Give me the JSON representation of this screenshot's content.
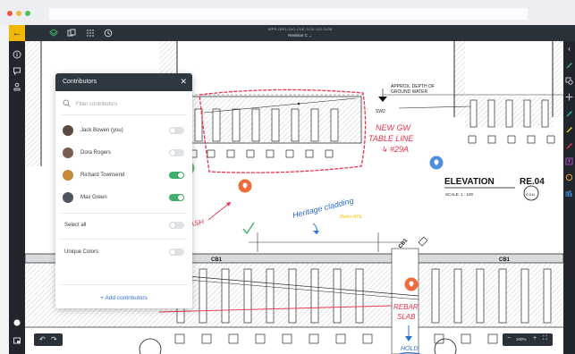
{
  "browser": {
    "dot_colors": [
      "#f0574a",
      "#f6b93b",
      "#4cc655"
    ]
  },
  "header": {
    "document_title": "WPR-DRG-JAC-CDE-3-00-102-3108",
    "revision_label": "Revision C",
    "revision_chevron": "⌄",
    "icons": [
      "layers-icon",
      "pages-icon",
      "grid-icon",
      "history-icon"
    ]
  },
  "left_toolbar": {
    "back_label": "←",
    "icons": [
      "info-icon",
      "comment-icon",
      "stamp-icon",
      "status-dot-icon",
      "settings-icon"
    ]
  },
  "right_toolbar": {
    "icons": [
      {
        "name": "chevron-left-icon",
        "color": "#ffffff"
      },
      {
        "name": "pen-green-icon",
        "color": "#3fb06a"
      },
      {
        "name": "shapes-icon",
        "color": "#cfd3d8"
      },
      {
        "name": "move-icon",
        "color": "#cfd3d8"
      },
      {
        "name": "pen-teal-icon",
        "color": "#27b5a6"
      },
      {
        "name": "pen-yellow-icon",
        "color": "#f2d20a"
      },
      {
        "name": "pen-red-icon",
        "color": "#e8334a"
      },
      {
        "name": "text-icon",
        "color": "#b54fd6"
      },
      {
        "name": "circle-icon",
        "color": "#f2a61b"
      },
      {
        "name": "measure-icon",
        "color": "#3b8fe0"
      }
    ]
  },
  "contributors_panel": {
    "title": "Contributors",
    "close_label": "✕",
    "filter_placeholder": "Filter contributors",
    "contributors": [
      {
        "name": "Jack Bowen (you)",
        "enabled": false,
        "avatar_color": "#5b4a3f"
      },
      {
        "name": "Dora Rogers",
        "enabled": false,
        "avatar_color": "#7a5c4e"
      },
      {
        "name": "Richard Townsend",
        "enabled": true,
        "avatar_color": "#c58a3a"
      },
      {
        "name": "Max Green",
        "enabled": true,
        "avatar_color": "#4c5560"
      }
    ],
    "select_all_label": "Select all",
    "select_all_enabled": false,
    "unique_colors_label": "Unique Colors",
    "unique_colors_enabled": false,
    "add_button_label": "+ Add contributors"
  },
  "drawing": {
    "approx_depth_line1": "APPROX. DEPTH OF",
    "approx_depth_line2": "GROUND WATER",
    "sw2_label": "SW2",
    "elevation_title": "ELEVATION",
    "elevation_code": "RE.04",
    "scale_label": "SCALE: 1 : 100",
    "sheet_ref": "S.011",
    "cb1_labels": [
      "CB1",
      "CB1",
      "CB1"
    ]
  },
  "annotations": {
    "new_gw_lines": [
      "NEW GW",
      "TABLE LINE",
      "↳ #29A"
    ],
    "beam_clash": "BEAM CLASH",
    "heritage_cladding": "Heritage cladding",
    "refer_ate": "Refer ATE",
    "rebar_lines": [
      "REBAR",
      "SLAB"
    ],
    "hold_label": "HOLD",
    "colors": {
      "red": "#e8334a",
      "blue": "#2f6fd1",
      "yellow": "#f2c200",
      "green": "#3fb06a"
    }
  },
  "footer": {
    "undo_label": "↶",
    "redo_label": "↷",
    "zoom_out_label": "−",
    "zoom_level": "100%",
    "zoom_in_label": "+",
    "fullscreen_label": "⛶"
  }
}
